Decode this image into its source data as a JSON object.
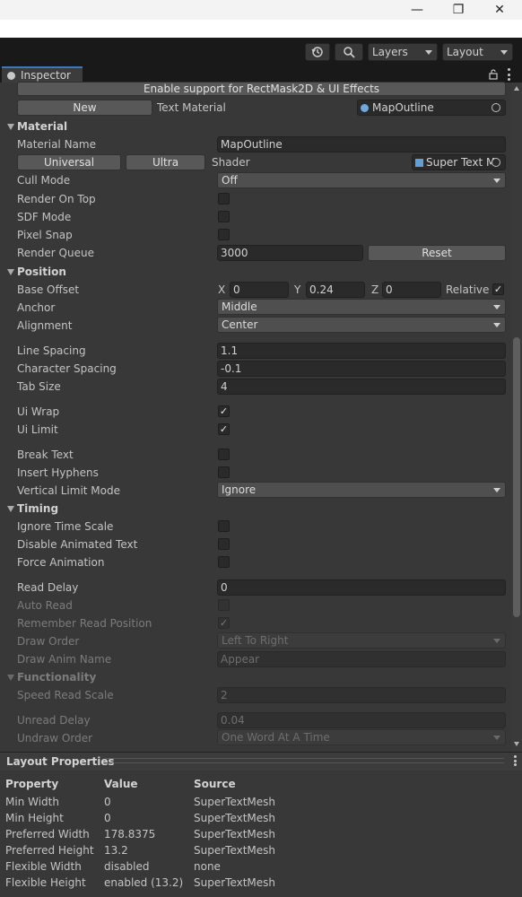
{
  "window": {
    "minimize": "—",
    "maximize": "❐",
    "close": "✕"
  },
  "toolbar": {
    "history_icon": "history-icon",
    "search_icon": "search-icon",
    "layers": "Layers",
    "layout": "Layout"
  },
  "tab": {
    "label": "Inspector"
  },
  "top": {
    "rectmask_button": "Enable support for RectMask2D & UI Effects",
    "new_button": "New",
    "text_material_label": "Text Material",
    "text_material_value": "MapOutline"
  },
  "material": {
    "header": "Material",
    "name_label": "Material Name",
    "name_value": "MapOutline",
    "universal": "Universal",
    "ultra": "Ultra",
    "shader_label": "Shader",
    "shader_value": "Super Text M",
    "cull_label": "Cull Mode",
    "cull_value": "Off",
    "render_on_top": "Render On Top",
    "sdf_mode": "SDF Mode",
    "pixel_snap": "Pixel Snap",
    "render_queue_label": "Render Queue",
    "render_queue_value": "3000",
    "reset": "Reset"
  },
  "position": {
    "header": "Position",
    "base_offset": "Base Offset",
    "x_label": "X",
    "x_value": "0",
    "y_label": "Y",
    "y_value": "0.24",
    "z_label": "Z",
    "z_value": "0",
    "relative": "Relative",
    "anchor_label": "Anchor",
    "anchor_value": "Middle",
    "alignment_label": "Alignment",
    "alignment_value": "Center",
    "line_spacing_label": "Line Spacing",
    "line_spacing_value": "1.1",
    "char_spacing_label": "Character Spacing",
    "char_spacing_value": "-0.1",
    "tab_size_label": "Tab Size",
    "tab_size_value": "4",
    "ui_wrap": "Ui Wrap",
    "ui_limit": "Ui Limit",
    "break_text": "Break Text",
    "insert_hyphens": "Insert Hyphens",
    "vertical_limit_label": "Vertical Limit Mode",
    "vertical_limit_value": "Ignore"
  },
  "timing": {
    "header": "Timing",
    "ignore_time_scale": "Ignore Time Scale",
    "disable_animated_text": "Disable Animated Text",
    "force_animation": "Force Animation",
    "read_delay_label": "Read Delay",
    "read_delay_value": "0",
    "auto_read": "Auto Read",
    "remember_read_position": "Remember Read Position",
    "draw_order_label": "Draw Order",
    "draw_order_value": "Left To Right",
    "draw_anim_label": "Draw Anim Name",
    "draw_anim_value": "Appear"
  },
  "functionality": {
    "header": "Functionality",
    "speed_read_label": "Speed Read Scale",
    "speed_read_value": "2",
    "unread_delay_label": "Unread Delay",
    "unread_delay_value": "0.04",
    "undraw_order_label": "Undraw Order",
    "undraw_order_value": "One Word At A Time"
  },
  "layout_properties": {
    "title": "Layout Properties",
    "columns": [
      "Property",
      "Value",
      "Source"
    ],
    "rows": [
      [
        "Min Width",
        "0",
        "SuperTextMesh"
      ],
      [
        "Min Height",
        "0",
        "SuperTextMesh"
      ],
      [
        "Preferred Width",
        "178.8375",
        "SuperTextMesh"
      ],
      [
        "Preferred Height",
        "13.2",
        "SuperTextMesh"
      ],
      [
        "Flexible Width",
        "disabled",
        "none"
      ],
      [
        "Flexible Height",
        "enabled (13.2)",
        "SuperTextMesh"
      ]
    ]
  }
}
